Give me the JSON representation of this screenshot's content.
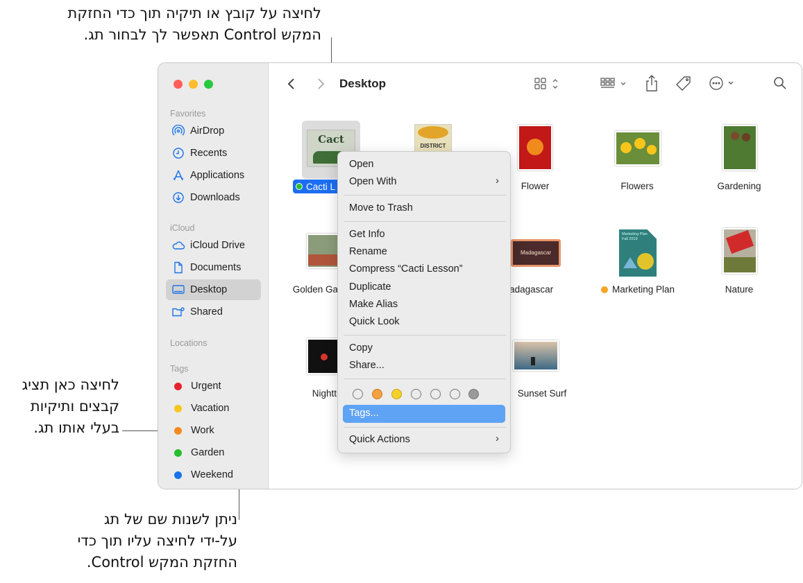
{
  "callouts": {
    "top": [
      "לחיצה על קובץ או תיקיה תוך כדי החזקת",
      "המקש Control תאפשר לך לבחור תג."
    ],
    "left": [
      "לחיצה כאן תציג",
      "קבצים ותיקיות",
      "בעלי אותו תג."
    ],
    "bottom": [
      "ניתן לשנות שם של תג",
      "על-ידי לחיצה עליו תוך כדי",
      "החזקת המקש Control."
    ]
  },
  "window": {
    "title": "Desktop",
    "traffic_lights": [
      "#ff5f57",
      "#febc2e",
      "#28c840"
    ]
  },
  "sidebar": {
    "favorites_label": "Favorites",
    "favorites": [
      {
        "label": "AirDrop",
        "icon": "airdrop-icon"
      },
      {
        "label": "Recents",
        "icon": "clock-icon"
      },
      {
        "label": "Applications",
        "icon": "applications-icon"
      },
      {
        "label": "Downloads",
        "icon": "download-icon"
      }
    ],
    "icloud_label": "iCloud",
    "icloud": [
      {
        "label": "iCloud Drive",
        "icon": "cloud-icon"
      },
      {
        "label": "Documents",
        "icon": "document-icon"
      },
      {
        "label": "Desktop",
        "icon": "desktop-icon",
        "selected": true
      },
      {
        "label": "Shared",
        "icon": "shared-folder-icon"
      }
    ],
    "locations_label": "Locations",
    "tags_label": "Tags",
    "tags": [
      {
        "label": "Urgent",
        "color": "#e8202a"
      },
      {
        "label": "Vacation",
        "color": "#f5c61c"
      },
      {
        "label": "Work",
        "color": "#f58a1f"
      },
      {
        "label": "Garden",
        "color": "#28bd2d"
      },
      {
        "label": "Weekend",
        "color": "#1a73e8"
      }
    ]
  },
  "files": {
    "row1": [
      {
        "name": "Cacti L",
        "thumb_text": "Cact",
        "selected": true,
        "tag_color": "#28bd2d"
      },
      {
        "name": "",
        "thumb_text": "DISTRICT"
      },
      {
        "name": "Flower"
      },
      {
        "name": "Flowers"
      },
      {
        "name": "Gardening"
      }
    ],
    "row2": [
      {
        "name": "Golden Ga"
      },
      {
        "name": ""
      },
      {
        "name": "Madagascar",
        "thumb_text": "Madagascar"
      },
      {
        "name": "Marketing Plan",
        "tag_color": "#f5a623",
        "thumb_text": "Marketing Plan Fall 2019"
      },
      {
        "name": "Nature"
      }
    ],
    "row3": [
      {
        "name": "Nightti"
      },
      {
        "name": ""
      },
      {
        "name": "Sunset Surf"
      }
    ]
  },
  "context_menu": {
    "items": [
      "Open",
      "Open With",
      "Move to Trash",
      "Get Info",
      "Rename",
      "Compress “Cacti Lesson”",
      "Duplicate",
      "Make Alias",
      "Quick Look",
      "Copy",
      "Share...",
      "Tags...",
      "Quick Actions"
    ],
    "tag_colors": [
      "none",
      "#f5a142",
      "#f5d02a",
      "none",
      "none",
      "none",
      "#9a9a9a"
    ]
  }
}
